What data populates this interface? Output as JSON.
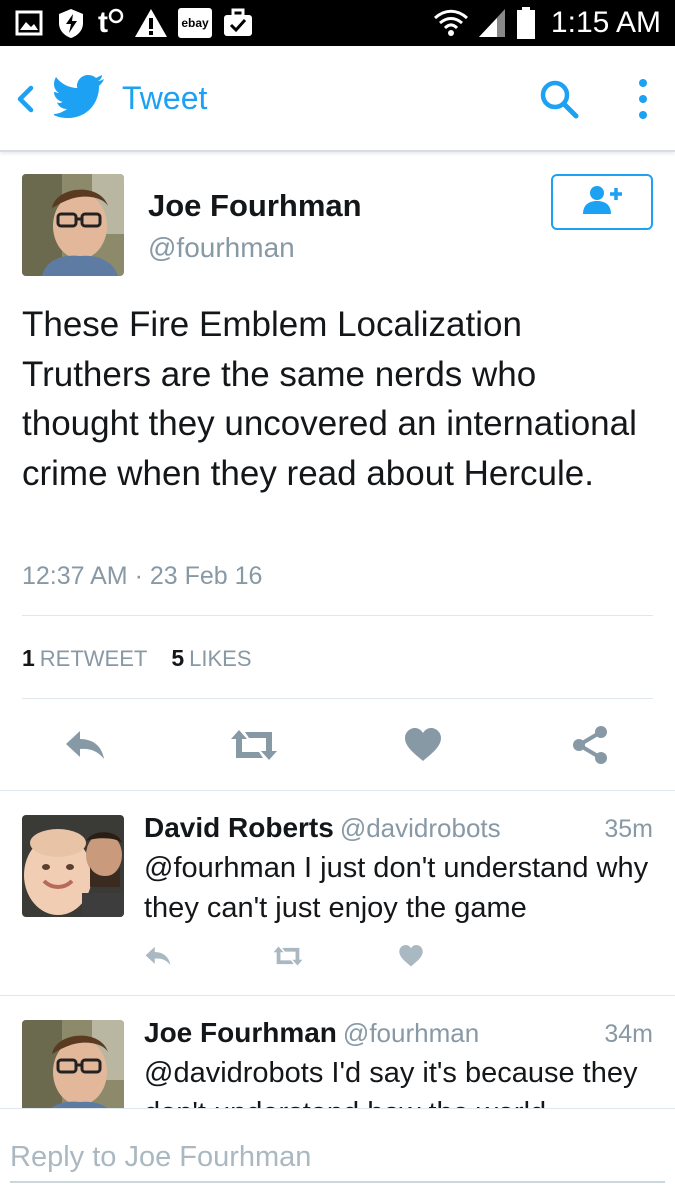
{
  "status_bar": {
    "time": "1:15 AM",
    "left_icons": [
      "gallery-icon",
      "sync-icon",
      "t-mobile-icon",
      "warning-icon",
      "ebay-icon",
      "briefcase-check-icon"
    ],
    "ebay_label": "ebay",
    "carrier_label": "t",
    "right_icons": [
      "wifi-icon",
      "signal-icon",
      "battery-icon"
    ]
  },
  "header": {
    "title": "Tweet",
    "accent_color": "#1da1f2"
  },
  "main_tweet": {
    "name": "Joe Fourhman",
    "handle": "@fourhman",
    "text": "These Fire Emblem Localization Truthers are the same nerds who thought they uncovered an international crime when they read about Hercule.",
    "timestamp": "12:37 AM · 23 Feb 16",
    "retweet_count": "1",
    "retweet_label": "RETWEET",
    "like_count": "5",
    "like_label": "LIKES",
    "actions": [
      "reply-icon",
      "retweet-icon",
      "heart-icon",
      "share-icon"
    ]
  },
  "replies": [
    {
      "name": "David Roberts",
      "handle": "@davidrobots",
      "time": "35m",
      "text": "@fourhman I just don't understand why they can't just enjoy the game"
    },
    {
      "name": "Joe Fourhman",
      "handle": "@fourhman",
      "time": "34m",
      "text": "@davidrobots I'd say it's because they don't understand how the world"
    }
  ],
  "composer": {
    "placeholder": "Reply to Joe Fourhman"
  }
}
